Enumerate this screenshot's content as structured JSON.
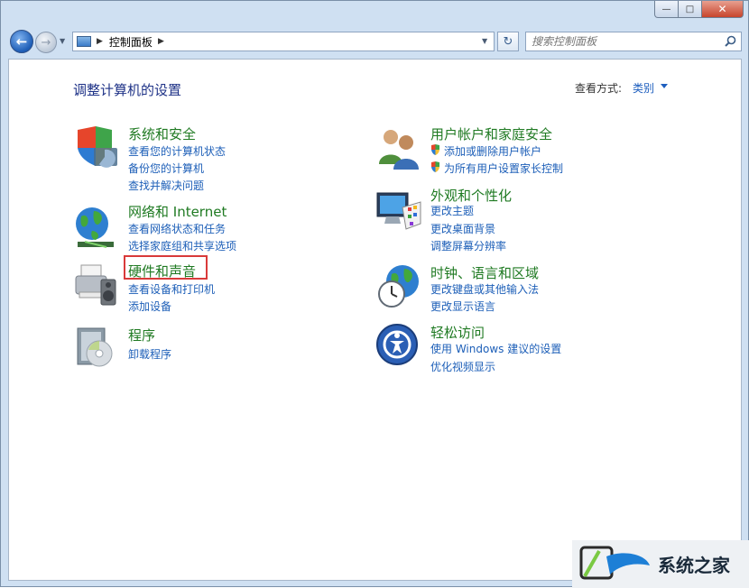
{
  "window": {
    "caption": {
      "minimize": "—",
      "maximize": "□",
      "close": "✕"
    }
  },
  "navbar": {
    "back_icon": "←",
    "forward_icon": "→",
    "breadcrumb": "控制面板",
    "search_placeholder": "搜索控制面板",
    "refresh_icon": "↻"
  },
  "main": {
    "title": "调整计算机的设置",
    "view_by_label": "查看方式:",
    "view_by_value": "类别"
  },
  "categories": [
    {
      "title": "系统和安全",
      "icon": "shield-computer-icon",
      "links": [
        "查看您的计算机状态",
        "备份您的计算机",
        "查找并解决问题"
      ]
    },
    {
      "title": "网络和 Internet",
      "icon": "network-globe-icon",
      "links": [
        "查看网络状态和任务",
        "选择家庭组和共享选项"
      ]
    },
    {
      "title": "硬件和声音",
      "icon": "printer-speaker-icon",
      "links": [
        "查看设备和打印机",
        "添加设备"
      ]
    },
    {
      "title": "程序",
      "icon": "programs-disc-icon",
      "links": [
        "卸载程序"
      ]
    },
    {
      "title": "用户帐户和家庭安全",
      "icon": "users-icon",
      "links": [
        "添加或删除用户帐户",
        "为所有用户设置家长控制"
      ]
    },
    {
      "title": "外观和个性化",
      "icon": "monitor-palette-icon",
      "links": [
        "更改主题",
        "更改桌面背景",
        "调整屏幕分辨率"
      ]
    },
    {
      "title": "时钟、语言和区域",
      "icon": "clock-globe-icon",
      "links": [
        "更改键盘或其他输入法",
        "更改显示语言"
      ]
    },
    {
      "title": "轻松访问",
      "icon": "ease-of-access-icon",
      "links": [
        "使用 Windows 建议的设置",
        "优化视频显示"
      ]
    }
  ],
  "watermark": {
    "text": "系统之家"
  },
  "colors": {
    "category_title": "#1f7a22",
    "link": "#1d5fb8",
    "highlight": "#d93a3a",
    "heading": "#1e3287"
  }
}
